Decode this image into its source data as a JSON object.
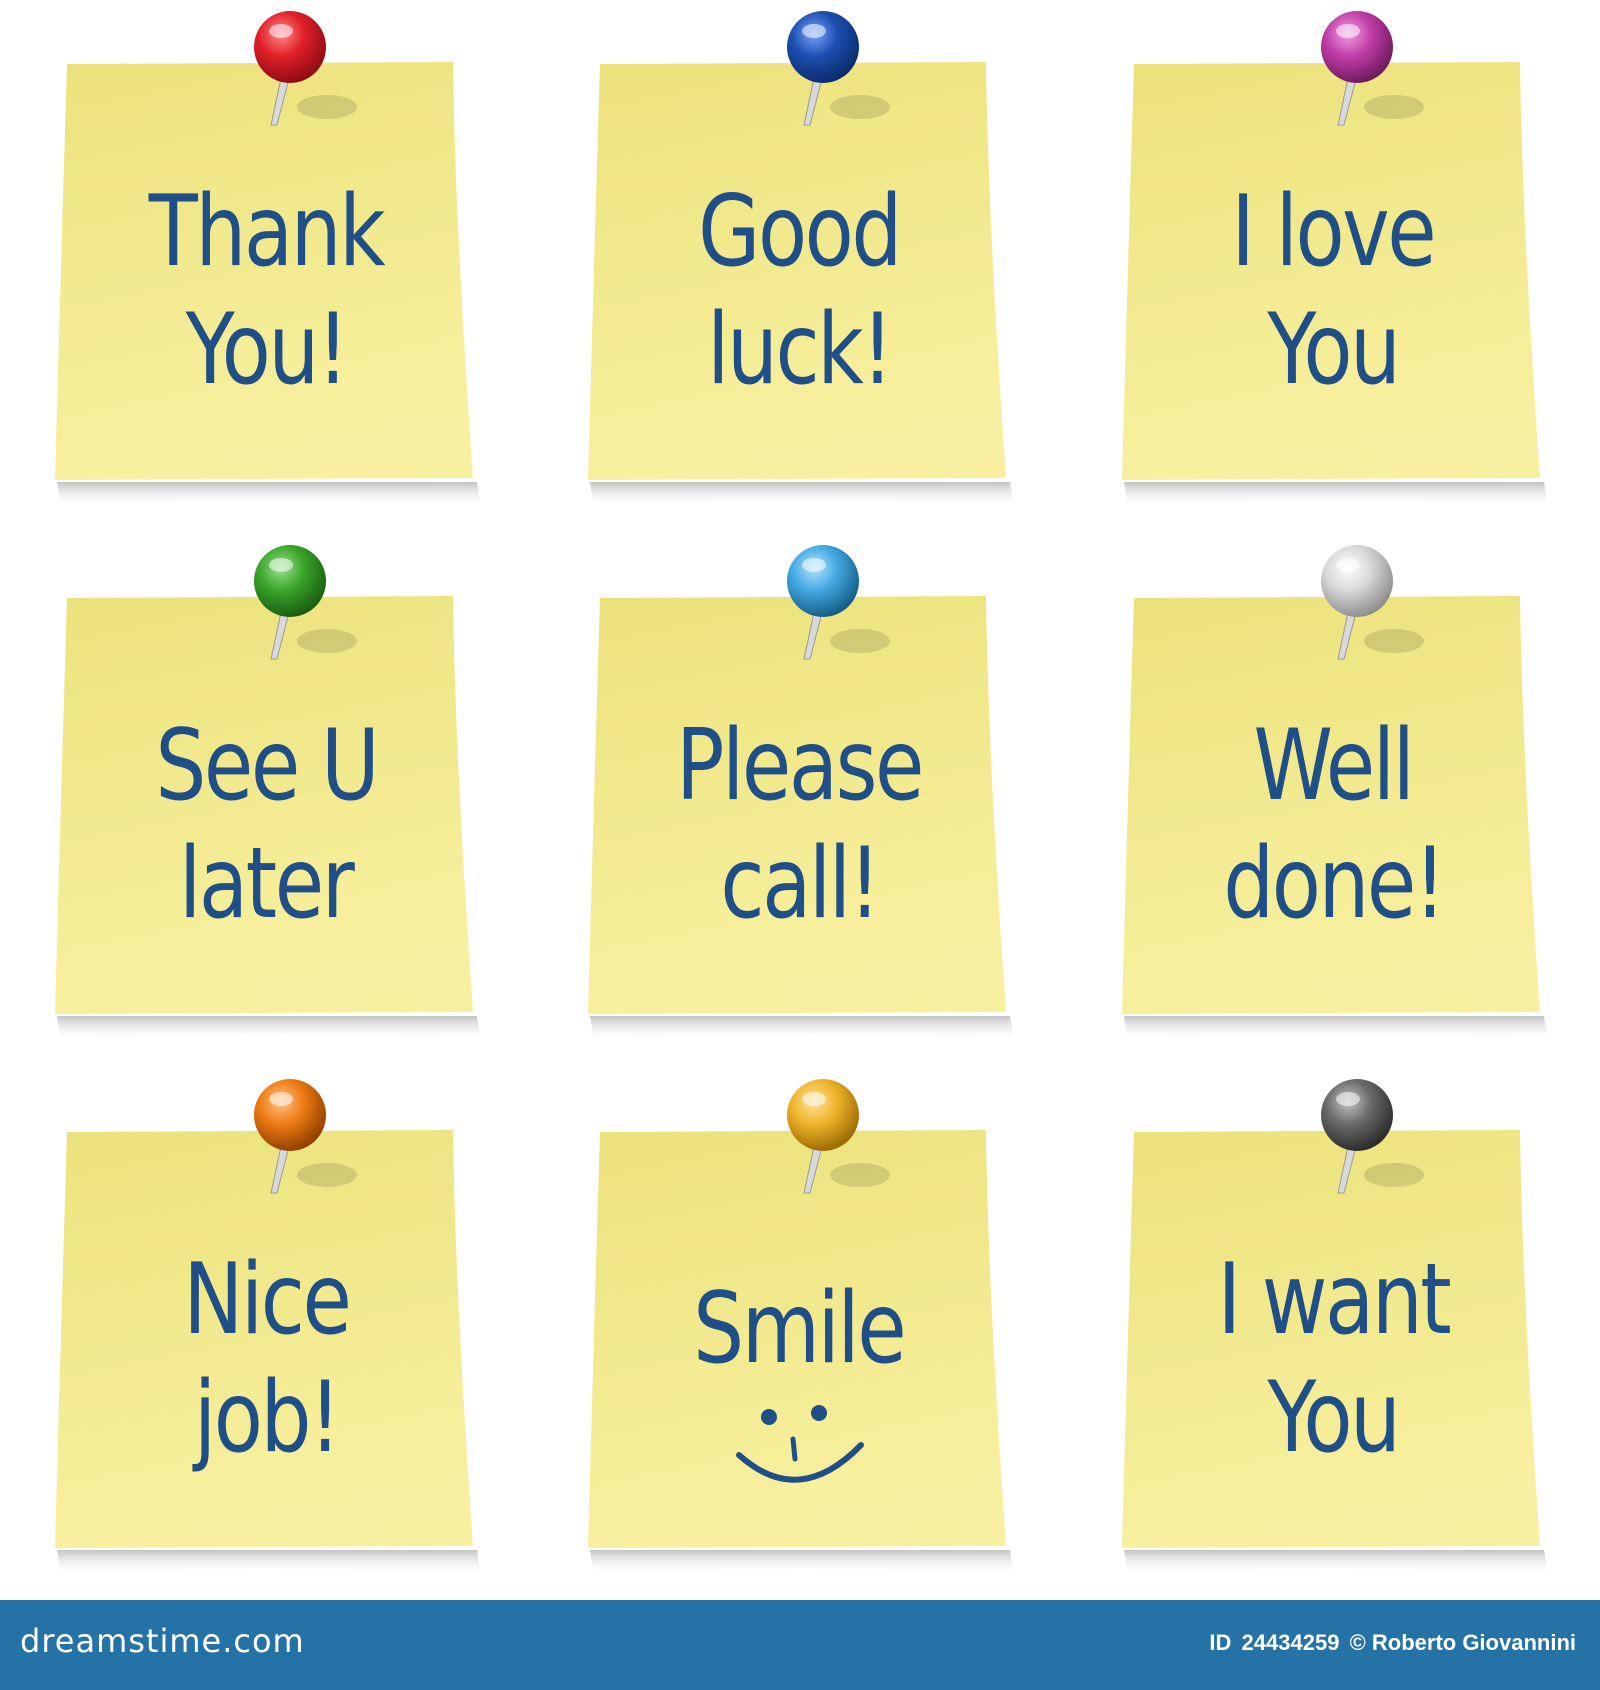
{
  "notes": [
    {
      "lines": [
        "Thank",
        "You!"
      ],
      "pin_color": "#e0202a",
      "pin_highlight": "#ff8a8a",
      "pin_shadow": "#8e0b12"
    },
    {
      "lines": [
        "Good",
        "luck!"
      ],
      "pin_color": "#1d4fb0",
      "pin_highlight": "#7ea4ff",
      "pin_shadow": "#0b2a6b"
    },
    {
      "lines": [
        "I love",
        "You"
      ],
      "pin_color": "#c13ea8",
      "pin_highlight": "#f3a1e2",
      "pin_shadow": "#6e1a5d"
    },
    {
      "lines": [
        "See U",
        "later"
      ],
      "pin_color": "#3aa52b",
      "pin_highlight": "#9ae28c",
      "pin_shadow": "#1a5c12"
    },
    {
      "lines": [
        "Please",
        "call!"
      ],
      "pin_color": "#43a9e2",
      "pin_highlight": "#b6e3ff",
      "pin_shadow": "#155d86"
    },
    {
      "lines": [
        "Well",
        "done!"
      ],
      "pin_color": "#d8d8d8",
      "pin_highlight": "#ffffff",
      "pin_shadow": "#8d8d8d"
    },
    {
      "lines": [
        "Nice",
        "job!"
      ],
      "pin_color": "#ee7a14",
      "pin_highlight": "#ffc38a",
      "pin_shadow": "#8e3f00"
    },
    {
      "lines": [
        "Smile"
      ],
      "smiley": true,
      "pin_color": "#f0b32c",
      "pin_highlight": "#ffe39a",
      "pin_shadow": "#9a6a00"
    },
    {
      "lines": [
        "I want",
        "You"
      ],
      "pin_color": "#6a6a6a",
      "pin_highlight": "#c4c4c4",
      "pin_shadow": "#2a2a2a"
    }
  ],
  "colors": {
    "note_top": "#ece27c",
    "note_bottom": "#f8f0a0",
    "ink": "#1f4f86",
    "footer": "#2472a6"
  },
  "footer": {
    "brand": "dreamstime.com",
    "id_label": "ID",
    "id_number": "24434259",
    "copyright": "© Roberto Giovannini"
  }
}
